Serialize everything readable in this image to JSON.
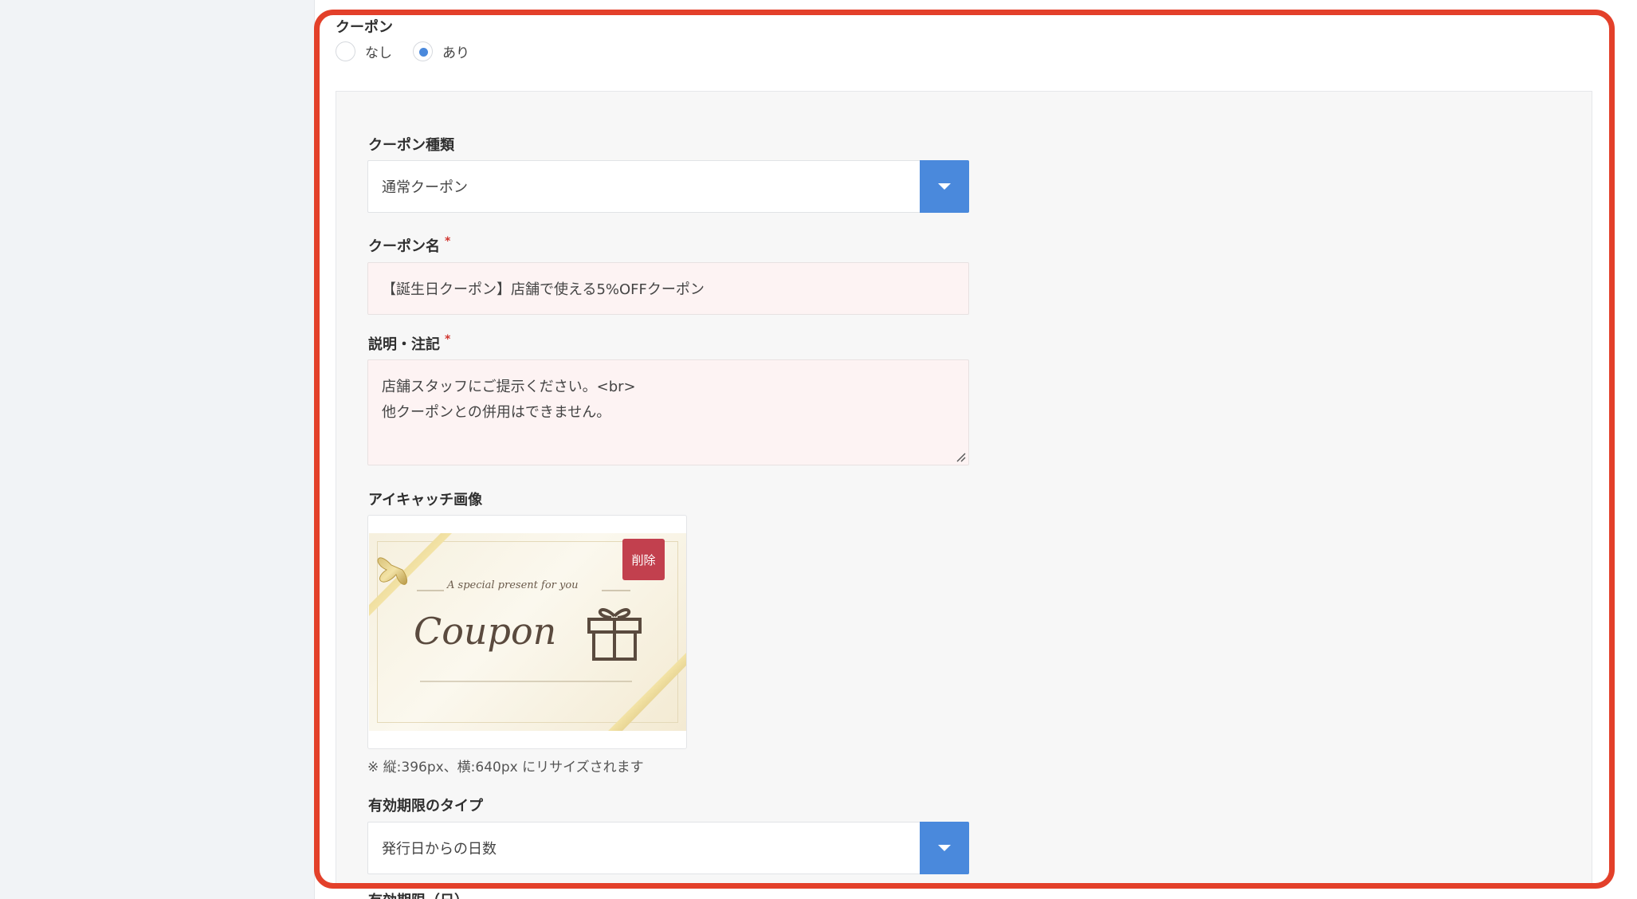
{
  "coupon_section": {
    "title": "クーポン",
    "options": [
      "なし",
      "あり"
    ],
    "selected": "あり"
  },
  "coupon_type": {
    "label": "クーポン種類",
    "value": "通常クーポン"
  },
  "coupon_name": {
    "label": "クーポン名",
    "required_mark": "*",
    "value": "【誕生日クーポン】店舗で使える5%OFFクーポン"
  },
  "description": {
    "label": "説明・注記",
    "required_mark": "*",
    "line1": "店舗スタッフにご提示ください。<br>",
    "line2": "他クーポンとの併用はできません。"
  },
  "eyecatch": {
    "label": "アイキャッチ画像",
    "delete_label": "削除",
    "image_tagline": "A special present for you",
    "image_title": "Coupon",
    "note": "※ 縦:396px、横:640px にリサイズされます"
  },
  "expiry_type": {
    "label": "有効期限のタイプ",
    "value": "発行日からの日数"
  },
  "next_field": {
    "label": "有効期限（日）"
  },
  "colors": {
    "accent": "#4a89dc",
    "highlight": "#e3402a",
    "danger": "#c2404e"
  }
}
